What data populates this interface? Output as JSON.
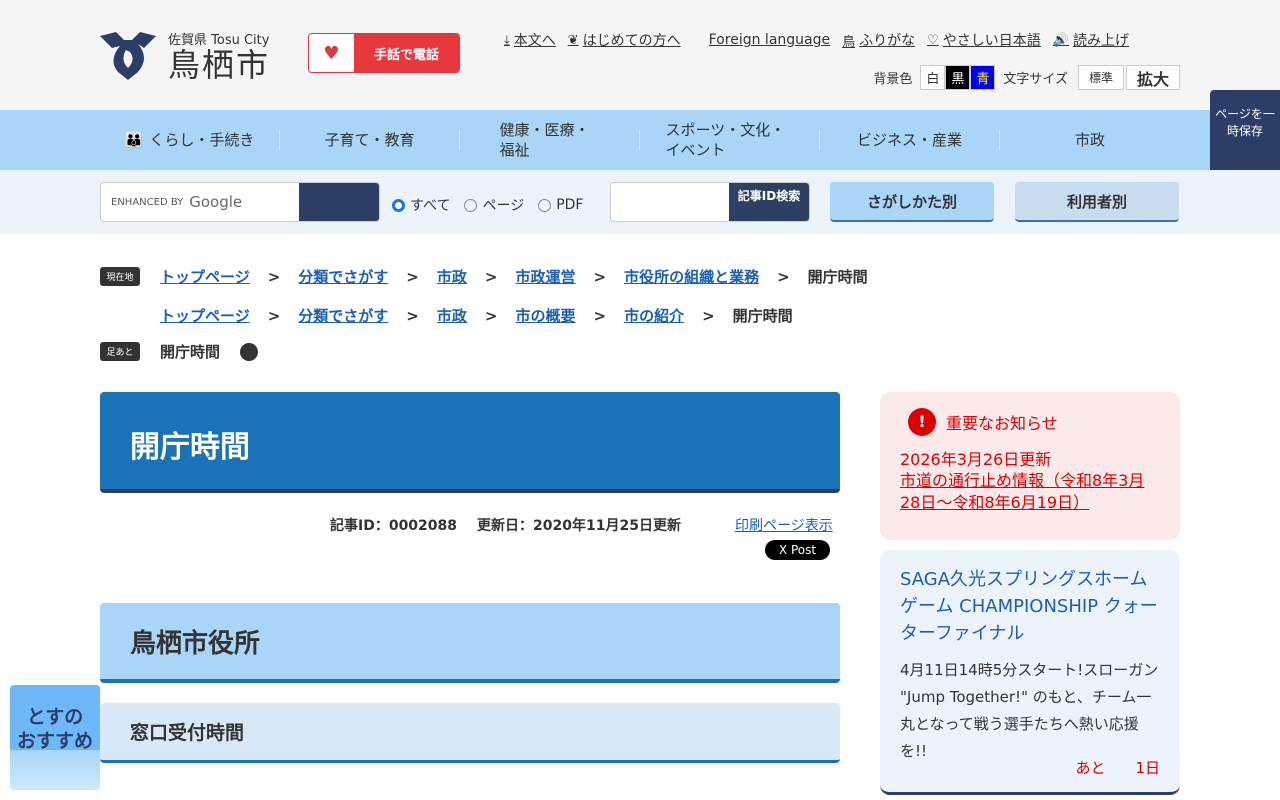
{
  "header": {
    "logo_sub": "佐賀県 Tosu City",
    "logo_name": "鳥栖市",
    "sign_phone": "手話で電話",
    "links": [
      {
        "icon": "download-icon",
        "label": "本文へ"
      },
      {
        "icon": "leaf-icon",
        "label": "はじめての方へ"
      },
      {
        "icon": "",
        "label": "Foreign language"
      },
      {
        "icon": "furigana-icon",
        "label": "ふりがな"
      },
      {
        "icon": "heart-icon",
        "label": "やさしい日本語"
      },
      {
        "icon": "speaker-icon",
        "label": "読み上げ"
      }
    ],
    "bg_label": "背景色",
    "bg_options": [
      "白",
      "黒",
      "青"
    ],
    "font_label": "文字サイズ",
    "font_options": [
      "標準",
      "拡大"
    ]
  },
  "nav": {
    "items": [
      "くらし・手続き",
      "子育て・教育",
      "健康・医療・福祉",
      "スポーツ・文化・イベント",
      "ビジネス・産業",
      "市政"
    ]
  },
  "save_page": "ページを一時保存",
  "search": {
    "google": "ENHANCED BY",
    "google_brand": "Google",
    "scopes": [
      "すべて",
      "ページ",
      "PDF"
    ],
    "id_search": "記事ID検索",
    "by_method": "さがしかた別",
    "by_user": "利用者別"
  },
  "breadcrumb": {
    "current_tag": "現在地",
    "trail1": [
      "トップページ",
      "分類でさがす",
      "市政",
      "市政運営",
      "市役所の組織と業務"
    ],
    "trail2": [
      "トップページ",
      "分類でさがす",
      "市政",
      "市の概要",
      "市の紹介"
    ],
    "current": "開庁時間",
    "history_tag": "足あと",
    "history": "開庁時間"
  },
  "article": {
    "title": "開庁時間",
    "id": "記事ID：0002088",
    "updated": "更新日：2020年11月25日更新",
    "print": "印刷ページ表示",
    "x_post": "X Post",
    "h2": "鳥栖市役所",
    "h3": "窓口受付時間"
  },
  "notice": {
    "title": "重要なお知らせ",
    "date": "2026年3月26日更新",
    "link": "市道の通行止め情報（令和8年3月28日～令和8年6月19日）"
  },
  "event": {
    "title": "SAGA久光スプリングスホームゲーム CHAMPIONSHIP クォーターファイナル",
    "desc": "4月11日14時5分スタート!スローガン \"Jump Together!\" のもと、チーム一丸となって戦う選手たちへ熱い応援を!!",
    "count_label": "あと",
    "count_value": "1日"
  },
  "osusume": {
    "line1": "とすの",
    "line2": "おすすめ"
  }
}
